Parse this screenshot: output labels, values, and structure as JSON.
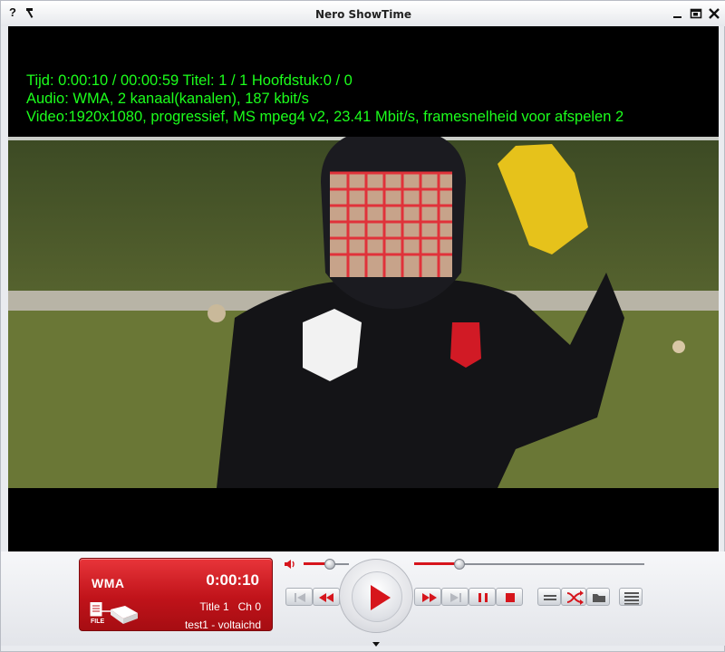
{
  "window": {
    "title": "Nero ShowTime",
    "help_icon": "?",
    "tools_icon": "hammer-icon"
  },
  "osd": {
    "line1": "Tijd: 0:00:10 / 00:00:59 Titel: 1 / 1 Hoofdstuk:0 / 0",
    "line2": "Audio: WMA, 2 kanaal(kanalen), 187 kbit/s",
    "line3": "Video:1920x1080, progressief, MS mpeg4 v2, 23.41 Mbit/s, framesnelheid voor afspelen 2"
  },
  "display": {
    "format": "WMA",
    "time": "0:00:10",
    "title_label": "Title  1",
    "chapter_label": "Ch 0",
    "filename": "test1 - voltaichd",
    "file_badge": "FILE"
  },
  "sliders": {
    "volume_level": 0.6,
    "position_level": 0.18
  },
  "colors": {
    "osd_text": "#1cff1c",
    "lcd_red": "#c0131a",
    "accent": "#d6151c"
  },
  "icons": {
    "speaker": "speaker-icon",
    "prev": "previous-icon",
    "rewind": "rewind-icon",
    "play": "play-icon",
    "forward": "fast-forward-icon",
    "next": "next-icon",
    "pause": "pause-icon",
    "stop": "stop-icon",
    "chapters": "list-icon",
    "shuffle": "shuffle-icon",
    "folder": "folder-icon",
    "playlist": "playlist-icon"
  }
}
